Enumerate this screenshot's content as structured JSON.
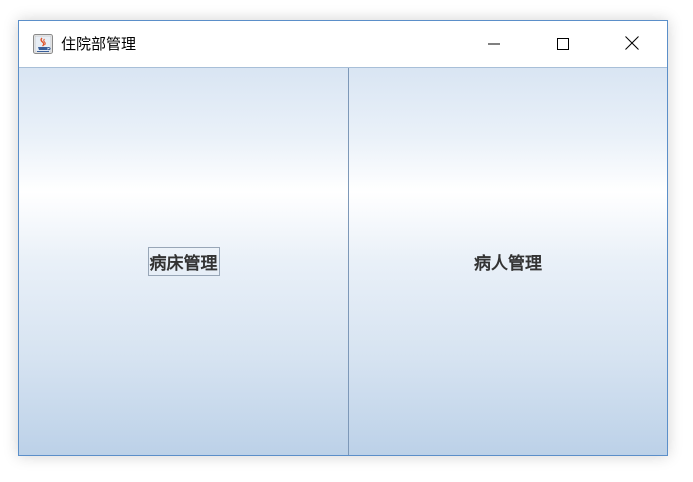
{
  "window": {
    "title": "住院部管理",
    "app_icon": "java-cup-icon",
    "controls": {
      "minimize_icon": "minimize-icon",
      "maximize_icon": "maximize-icon",
      "close_icon": "close-icon"
    }
  },
  "buttons": {
    "bed_management": "病床管理",
    "patient_management": "病人管理"
  },
  "colors": {
    "window_border": "#5b8fc9",
    "button_gradient_top": "#d9e5f3",
    "button_gradient_light": "#ffffff",
    "button_gradient_bottom": "#bcd1e8",
    "button_text": "#333333"
  }
}
